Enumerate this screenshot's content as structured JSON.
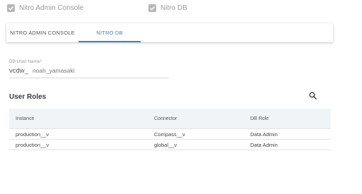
{
  "checkboxes": [
    {
      "label": "Nitro Admin Console",
      "checked": true
    },
    {
      "label": "Nitro DB",
      "checked": true
    }
  ],
  "tabs": [
    {
      "label": "NITRO ADMIN CONSOLE",
      "active": false
    },
    {
      "label": "NITRO DB",
      "active": true
    }
  ],
  "db_user": {
    "label": "DB User Name*",
    "prefix": "vcdw_",
    "value": "noah_yamasaki"
  },
  "user_roles": {
    "title": "User Roles",
    "search_icon": "search-icon",
    "columns": [
      "Instance",
      "Connector",
      "DB Role"
    ],
    "rows": [
      {
        "instance": "production__v",
        "connector": "Compass__v",
        "role": "Data Admin"
      },
      {
        "instance": "production__v",
        "connector": "global__v",
        "role": "Data Admin"
      }
    ]
  },
  "colors": {
    "accent": "#3f7fd0",
    "checkbox": "#b6b6b6",
    "table_header_bg": "#f1f4f7"
  }
}
